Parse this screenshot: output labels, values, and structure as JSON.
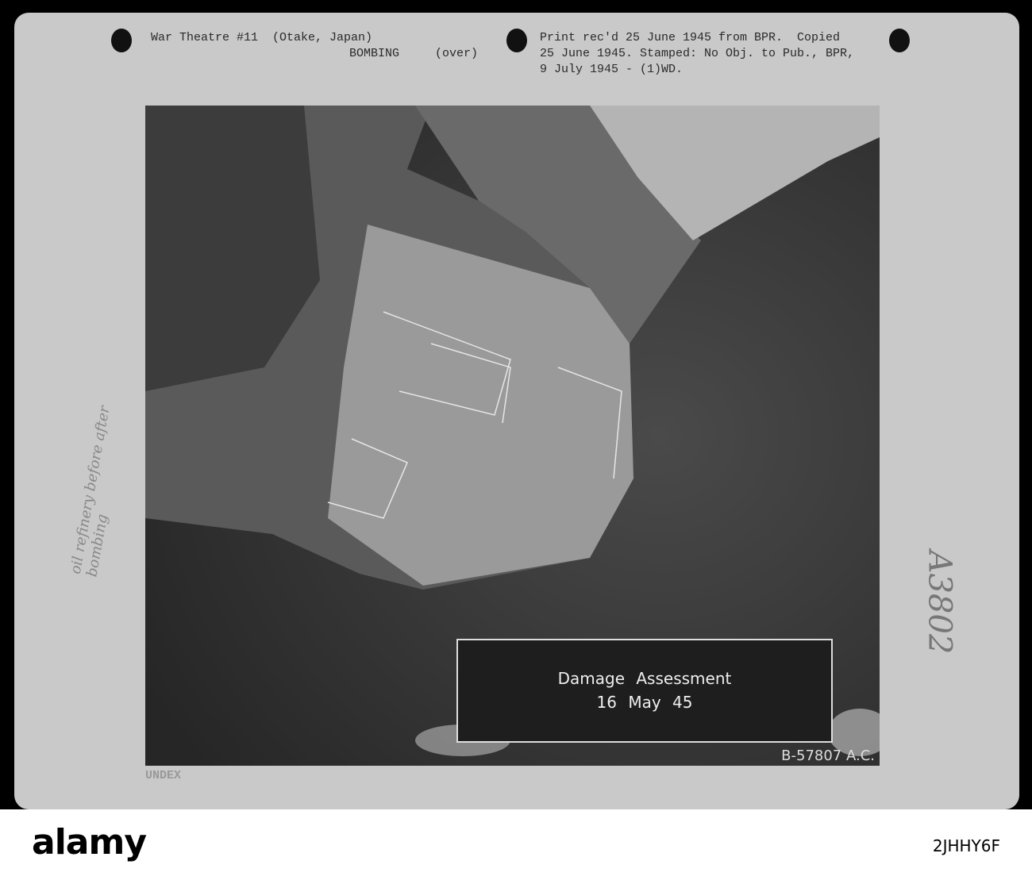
{
  "card": {
    "header_left_line1": "War Theatre #11  (Otake, Japan)",
    "header_left_line2": "BOMBING     (over)",
    "header_right_line1": "Print rec'd 25 June 1945 from BPR.  Copied",
    "header_right_line2": "25 June 1945. Stamped: No Obj. to Pub., BPR,",
    "header_right_line3": "9 July 1945 - (1)WD.",
    "handwritten_left": "oil refinery before after bombing",
    "handwritten_right": "A3802",
    "stamp_bottom": "UNDEX"
  },
  "photo": {
    "caption_line1": "Damage Assessment",
    "caption_line2": "16 May 45",
    "serial": "B-57807 A.C."
  },
  "banner": {
    "logo": "alamy",
    "image_id": "2JHHY6F"
  }
}
